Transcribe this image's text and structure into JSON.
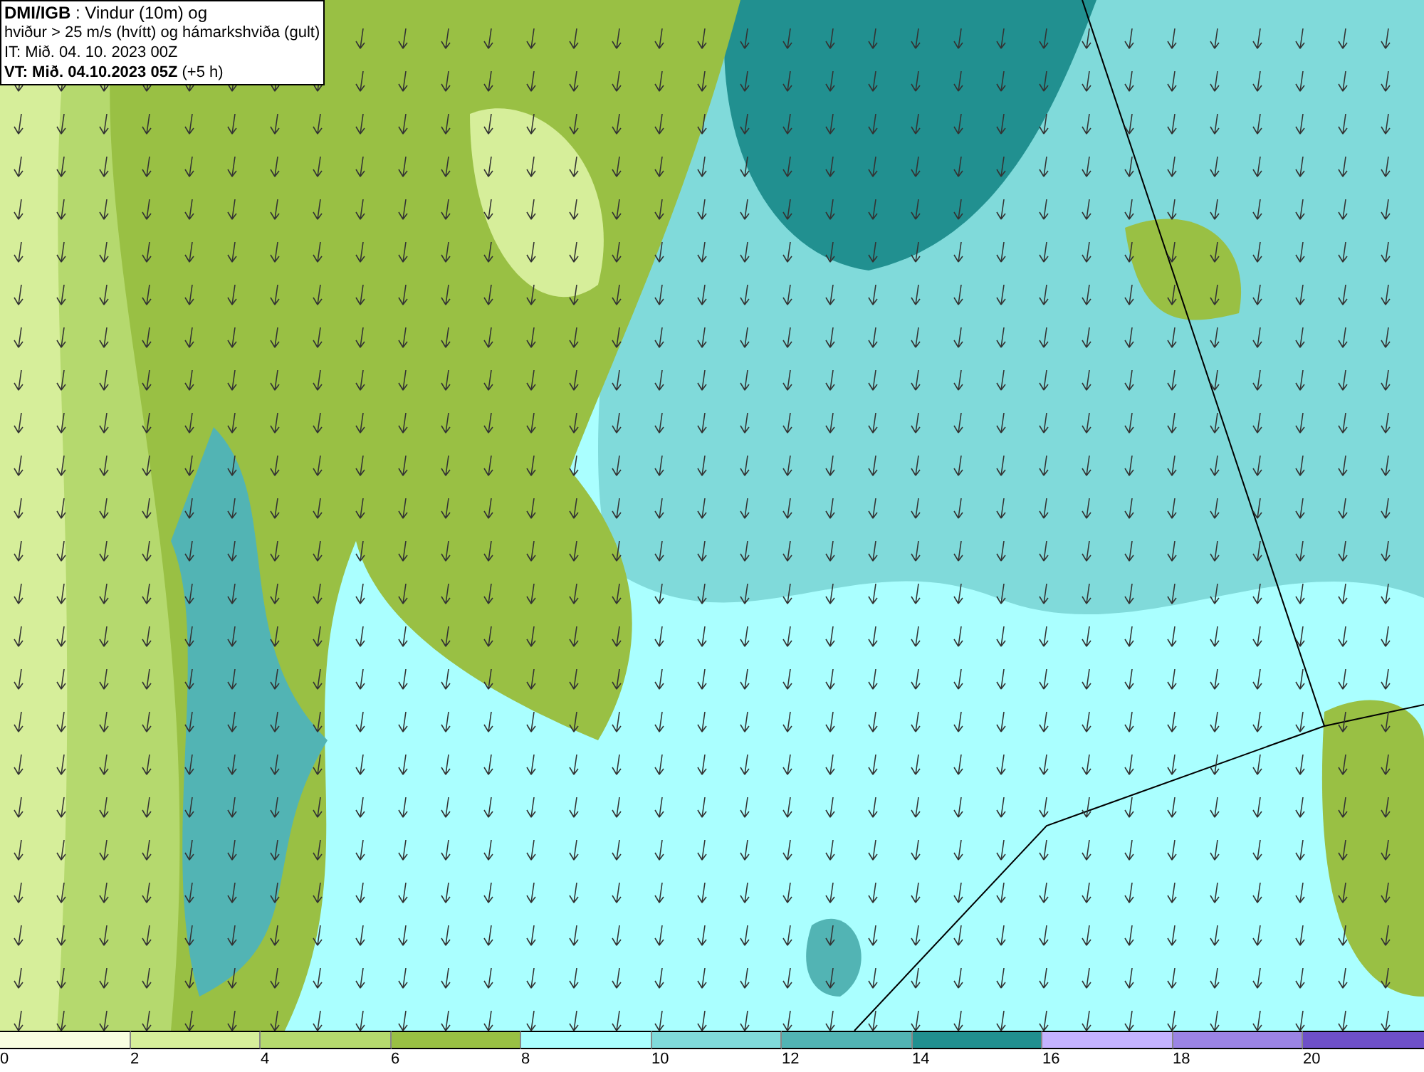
{
  "title_box": {
    "lines": [
      "**DMI/IGB** : Vindur (10m) og",
      "hviður > 25 m/s (hvítt) og hámarkshviða (gult)",
      "IT: Mið. 04. 10. 2023 00Z",
      "**VT: Mið. 04.10.2023 05Z** (+5 h)"
    ]
  },
  "legend": [
    {
      "label": "0",
      "color": "#f8fde0"
    },
    {
      "label": "2",
      "color": "#d6ee9a"
    },
    {
      "label": "4",
      "color": "#b5d96e"
    },
    {
      "label": "6",
      "color": "#99c044"
    },
    {
      "label": "8",
      "color": "#aaffff"
    },
    {
      "label": "10",
      "color": "#80dada"
    },
    {
      "label": "12",
      "color": "#52b4b4"
    },
    {
      "label": "14",
      "color": "#219090"
    },
    {
      "label": "16",
      "color": "#c4b3ff"
    },
    {
      "label": "18",
      "color": "#9b84e4"
    },
    {
      "label": "20",
      "color": "#6e50c8"
    }
  ]
}
